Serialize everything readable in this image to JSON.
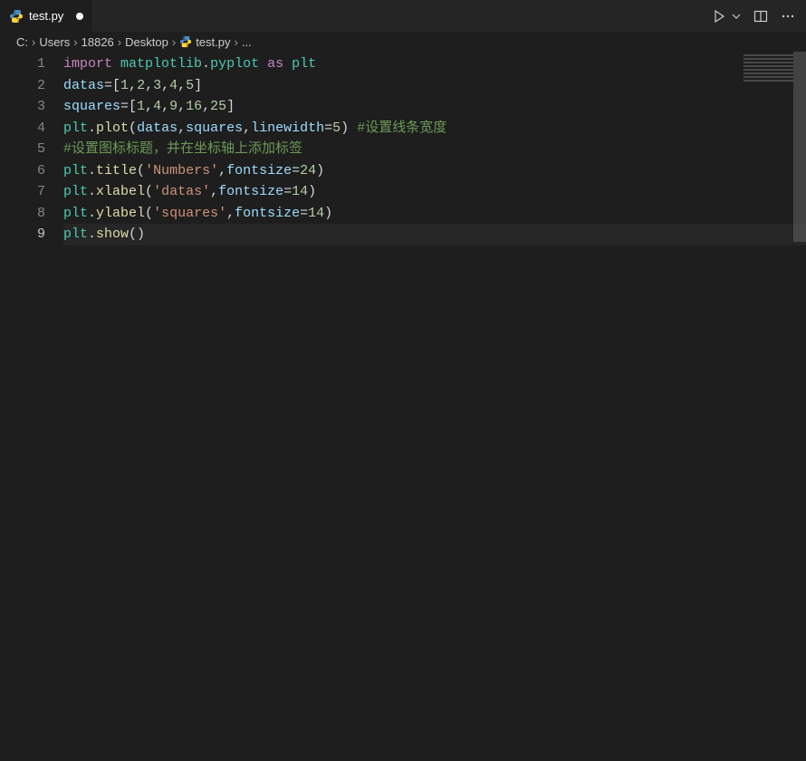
{
  "tab": {
    "label": "test.py",
    "dirty": true,
    "icon": "python-file-icon"
  },
  "title_actions": {
    "run": "run-icon",
    "run_dropdown": "chevron-down-icon",
    "split": "split-editor-icon",
    "more": "more-icon"
  },
  "breadcrumbs": {
    "items": [
      "C:",
      "Users",
      "18826",
      "Desktop",
      "test.py",
      "..."
    ],
    "sep": "›"
  },
  "editor": {
    "active_line": 9,
    "lines": [
      {
        "n": 1,
        "tokens": [
          {
            "t": "import",
            "c": "kw"
          },
          {
            "t": " ",
            "c": "op"
          },
          {
            "t": "matplotlib",
            "c": "mod"
          },
          {
            "t": ".",
            "c": "pun"
          },
          {
            "t": "pyplot",
            "c": "mod"
          },
          {
            "t": " ",
            "c": "op"
          },
          {
            "t": "as",
            "c": "kw"
          },
          {
            "t": " ",
            "c": "op"
          },
          {
            "t": "plt",
            "c": "mod"
          }
        ]
      },
      {
        "n": 2,
        "tokens": [
          {
            "t": "datas",
            "c": "var"
          },
          {
            "t": "=[",
            "c": "pun"
          },
          {
            "t": "1",
            "c": "num"
          },
          {
            "t": ",",
            "c": "pun"
          },
          {
            "t": "2",
            "c": "num"
          },
          {
            "t": ",",
            "c": "pun"
          },
          {
            "t": "3",
            "c": "num"
          },
          {
            "t": ",",
            "c": "pun"
          },
          {
            "t": "4",
            "c": "num"
          },
          {
            "t": ",",
            "c": "pun"
          },
          {
            "t": "5",
            "c": "num"
          },
          {
            "t": "]",
            "c": "pun"
          }
        ]
      },
      {
        "n": 3,
        "tokens": [
          {
            "t": "squares",
            "c": "var"
          },
          {
            "t": "=[",
            "c": "pun"
          },
          {
            "t": "1",
            "c": "num"
          },
          {
            "t": ",",
            "c": "pun"
          },
          {
            "t": "4",
            "c": "num"
          },
          {
            "t": ",",
            "c": "pun"
          },
          {
            "t": "9",
            "c": "num"
          },
          {
            "t": ",",
            "c": "pun"
          },
          {
            "t": "16",
            "c": "num"
          },
          {
            "t": ",",
            "c": "pun"
          },
          {
            "t": "25",
            "c": "num"
          },
          {
            "t": "]",
            "c": "pun"
          }
        ]
      },
      {
        "n": 4,
        "tokens": [
          {
            "t": "plt",
            "c": "mod"
          },
          {
            "t": ".",
            "c": "pun"
          },
          {
            "t": "plot",
            "c": "fn"
          },
          {
            "t": "(",
            "c": "pun"
          },
          {
            "t": "datas",
            "c": "var"
          },
          {
            "t": ",",
            "c": "pun"
          },
          {
            "t": "squares",
            "c": "var"
          },
          {
            "t": ",",
            "c": "pun"
          },
          {
            "t": "linewidth",
            "c": "param"
          },
          {
            "t": "=",
            "c": "pun"
          },
          {
            "t": "5",
            "c": "num"
          },
          {
            "t": ") ",
            "c": "pun"
          },
          {
            "t": "#设置线条宽度",
            "c": "cmt"
          }
        ]
      },
      {
        "n": 5,
        "tokens": [
          {
            "t": "#设置图标标题，并在坐标轴上添加标签",
            "c": "cmt"
          }
        ]
      },
      {
        "n": 6,
        "tokens": [
          {
            "t": "plt",
            "c": "mod"
          },
          {
            "t": ".",
            "c": "pun"
          },
          {
            "t": "title",
            "c": "fn"
          },
          {
            "t": "(",
            "c": "pun"
          },
          {
            "t": "'Numbers'",
            "c": "str"
          },
          {
            "t": ",",
            "c": "pun"
          },
          {
            "t": "fontsize",
            "c": "param"
          },
          {
            "t": "=",
            "c": "pun"
          },
          {
            "t": "24",
            "c": "num"
          },
          {
            "t": ")",
            "c": "pun"
          }
        ]
      },
      {
        "n": 7,
        "tokens": [
          {
            "t": "plt",
            "c": "mod"
          },
          {
            "t": ".",
            "c": "pun"
          },
          {
            "t": "xlabel",
            "c": "fn"
          },
          {
            "t": "(",
            "c": "pun"
          },
          {
            "t": "'datas'",
            "c": "str"
          },
          {
            "t": ",",
            "c": "pun"
          },
          {
            "t": "fontsize",
            "c": "param"
          },
          {
            "t": "=",
            "c": "pun"
          },
          {
            "t": "14",
            "c": "num"
          },
          {
            "t": ")",
            "c": "pun"
          }
        ]
      },
      {
        "n": 8,
        "tokens": [
          {
            "t": "plt",
            "c": "mod"
          },
          {
            "t": ".",
            "c": "pun"
          },
          {
            "t": "ylabel",
            "c": "fn"
          },
          {
            "t": "(",
            "c": "pun"
          },
          {
            "t": "'squares'",
            "c": "str"
          },
          {
            "t": ",",
            "c": "pun"
          },
          {
            "t": "fontsize",
            "c": "param"
          },
          {
            "t": "=",
            "c": "pun"
          },
          {
            "t": "14",
            "c": "num"
          },
          {
            "t": ")",
            "c": "pun"
          }
        ]
      },
      {
        "n": 9,
        "tokens": [
          {
            "t": "plt",
            "c": "mod"
          },
          {
            "t": ".",
            "c": "pun"
          },
          {
            "t": "show",
            "c": "fn"
          },
          {
            "t": "()",
            "c": "pun"
          }
        ]
      }
    ]
  }
}
